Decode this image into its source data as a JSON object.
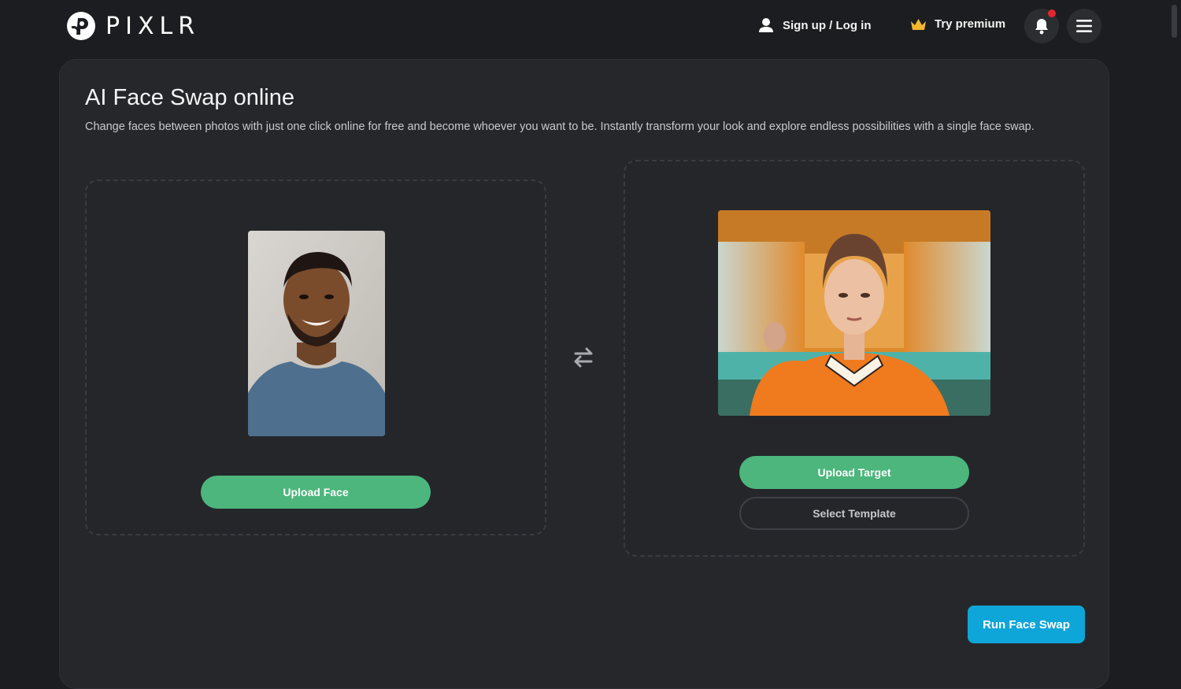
{
  "header": {
    "logo_text": "PIXLR",
    "auth_label": "Sign up / Log in",
    "premium_label": "Try premium",
    "icons": {
      "user": "user-icon",
      "crown": "crown-icon",
      "bell": "bell-icon",
      "menu": "hamburger-menu-icon"
    }
  },
  "main": {
    "title": "AI Face Swap online",
    "description": "Change faces between photos with just one click online for free and become whoever you want to be. Instantly transform your look and explore endless possibilities with a single face swap.",
    "face_panel": {
      "upload_label": "Upload Face"
    },
    "target_panel": {
      "upload_label": "Upload Target",
      "template_label": "Select Template"
    },
    "run_label": "Run Face Swap"
  },
  "colors": {
    "background": "#1c1d20",
    "card": "#26272b",
    "green_button": "#4cb67c",
    "run_button": "#0ea5d9",
    "notification_dot": "#e3262e"
  }
}
